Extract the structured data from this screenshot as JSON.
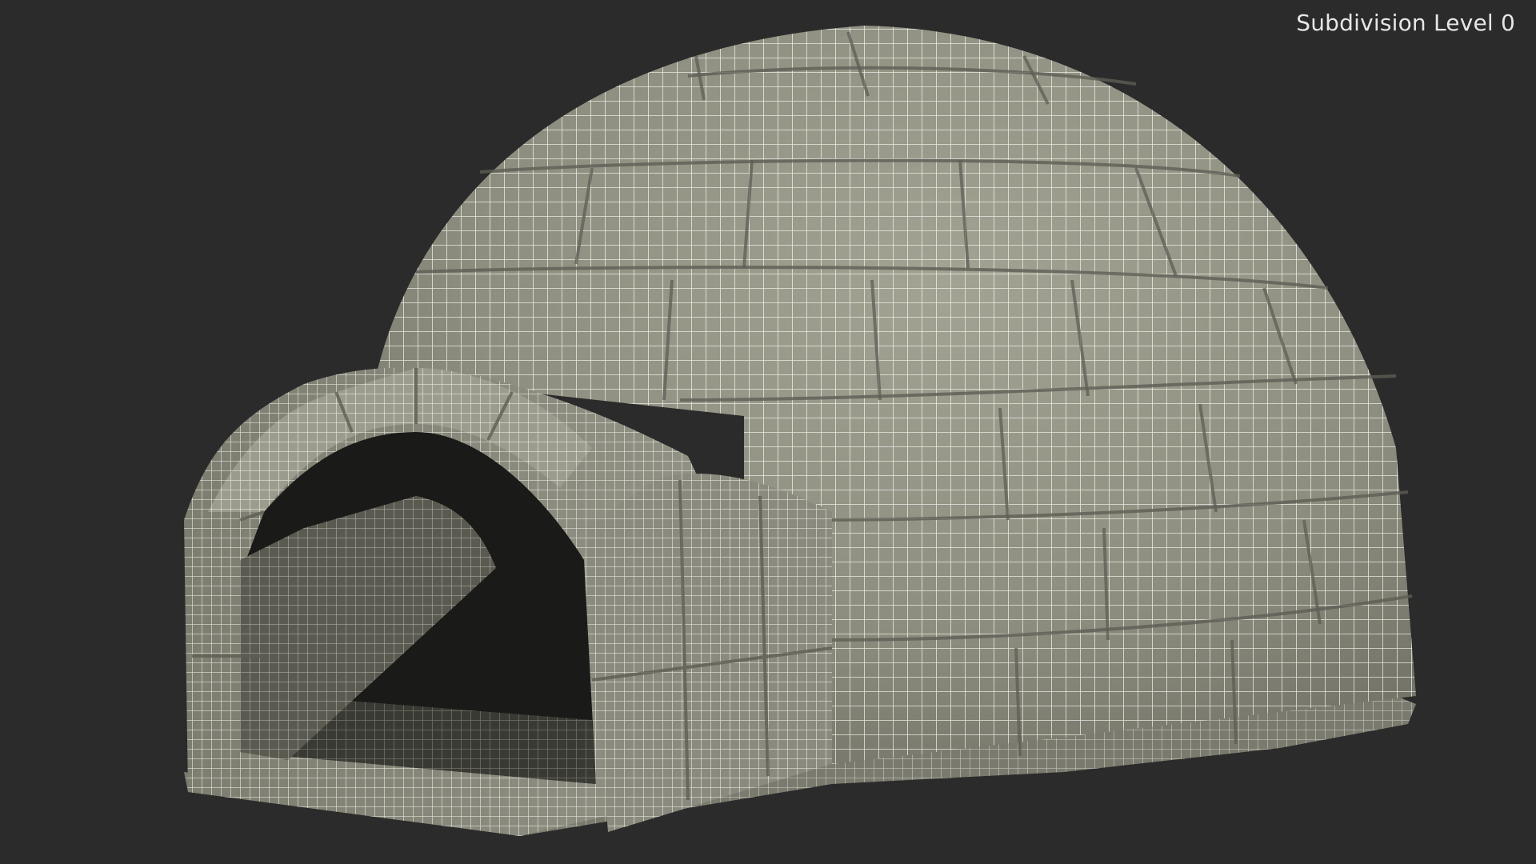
{
  "overlay": {
    "subdivision_label": "Subdivision Level 0"
  },
  "colors": {
    "background": "#2b2b2b",
    "surface": "#8e8e80",
    "surface_light": "#a3a394",
    "surface_dark": "#6f6f64",
    "wire": "#f2f2ea",
    "interior": "#1a1a18"
  },
  "scene": {
    "subject": "igloo-wireframe-model"
  }
}
